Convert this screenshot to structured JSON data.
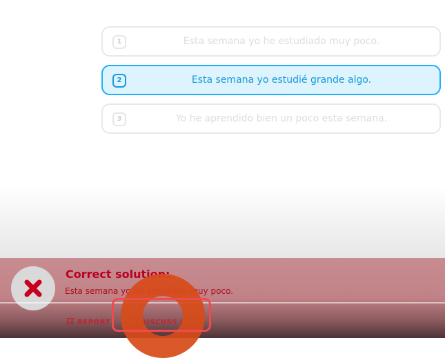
{
  "choices": [
    {
      "number": "1",
      "text": "Esta semana yo he estudiado muy poco."
    },
    {
      "number": "2",
      "text": "Esta semana yo estudié grande algo."
    },
    {
      "number": "3",
      "text": "Yo he aprendido bien un poco esta semana."
    }
  ],
  "selected_choice": "2",
  "feedback": {
    "status_icon": "close-icon",
    "title": "Correct solution:",
    "answer": "Esta semana yo he estudiado muy poco.",
    "report_label": "REPORT",
    "discuss_label": "DISCUSS (",
    "report_icon": "flag-icon",
    "discuss_icon": "comment-icon"
  },
  "colors": {
    "selected_border": "#1cb0f6",
    "selected_text": "#1899d6",
    "selected_fill": "#ddf4ff",
    "error_red": "#b8001f",
    "feedback_band": "#c88d91",
    "highlight_box": "#ee4b4f",
    "tap_indicator": "#d74b19"
  }
}
